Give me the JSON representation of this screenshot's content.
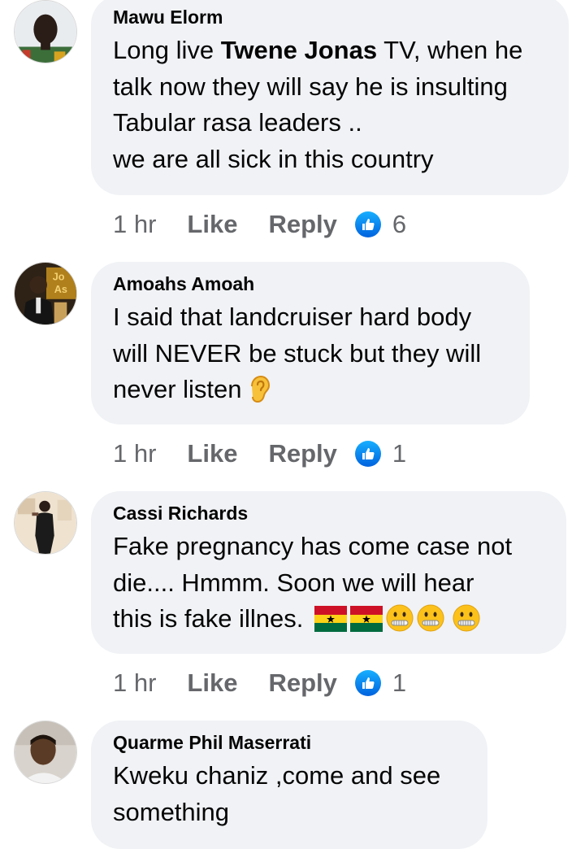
{
  "comments": [
    {
      "author": "Mawu Elorm",
      "lines": [
        {
          "before": "Long live ",
          "bold": "Twene Jonas",
          "after": " TV, when he"
        },
        "talk now they will say he is insulting",
        "Tabular rasa leaders ..",
        "we are all sick in this country"
      ],
      "time": "1 hr",
      "like_label": "Like",
      "reply_label": "Reply",
      "reaction_count": "6",
      "reaction_icon": "thumbs-up-icon"
    },
    {
      "author": "Amoahs Amoah",
      "lines": [
        "I said that landcruiser hard body",
        "will NEVER be stuck but they will",
        "never listen"
      ],
      "line_emojis": [
        "ear-emoji"
      ],
      "time": "1 hr",
      "like_label": "Like",
      "reply_label": "Reply",
      "reaction_count": "1",
      "reaction_icon": "thumbs-up-icon",
      "avatar_text": [
        "Jo",
        "As"
      ]
    },
    {
      "author": "Cassi Richards",
      "lines": [
        "Fake pregnancy has come case not",
        "die.... Hmmm. Soon we will hear",
        "this is fake illnes."
      ],
      "line_emojis": [
        "ghana-flag-emoji",
        "ghana-flag-emoji",
        "zipper-mouth-emoji",
        "zipper-mouth-emoji",
        "zipper-mouth-emoji"
      ],
      "time": "1 hr",
      "like_label": "Like",
      "reply_label": "Reply",
      "reaction_count": "1",
      "reaction_icon": "thumbs-up-icon"
    },
    {
      "author": "Quarme Phil Maserrati",
      "lines": [
        "Kweku chaniz ,come and see",
        "something"
      ]
    }
  ],
  "colors": {
    "bubble": "#f0f2f5",
    "meta_text": "#65676b",
    "like_blue": "#1877f2",
    "ghana_red": "#ce1126",
    "ghana_gold": "#fcd116",
    "ghana_green": "#006b3f"
  }
}
